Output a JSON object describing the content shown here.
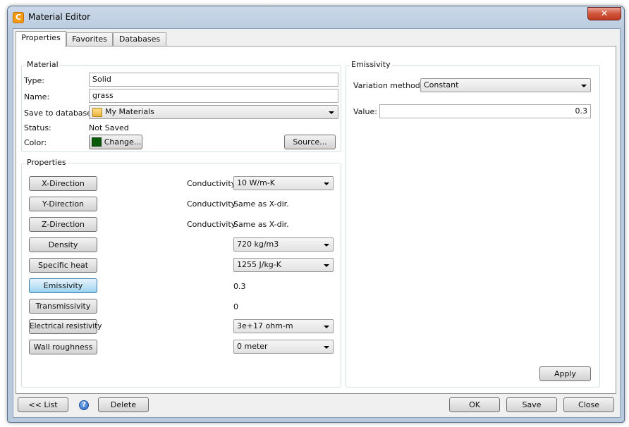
{
  "window": {
    "title": "Material Editor",
    "app_icon_letter": "C",
    "close_glyph": "✕"
  },
  "tabs": [
    {
      "label": "Properties",
      "active": true
    },
    {
      "label": "Favorites",
      "active": false
    },
    {
      "label": "Databases",
      "active": false
    }
  ],
  "material": {
    "group_label": "Material",
    "type_label": "Type:",
    "type_value": "Solid",
    "name_label": "Name:",
    "name_value": "grass",
    "save_to_db_label": "Save to database:",
    "save_to_db_value": "My Materials",
    "status_label": "Status:",
    "status_value": "Not Saved",
    "color_label": "Color:",
    "color_value": "#0a5a0a",
    "change_button": "Change...",
    "source_button": "Source..."
  },
  "properties": {
    "group_label": "Properties",
    "rows": [
      {
        "button": "X-Direction",
        "prefix": "Conductivity",
        "value": "10 W/m-K",
        "kind": "combo"
      },
      {
        "button": "Y-Direction",
        "prefix": "Conductivity",
        "value": "Same as X-dir.",
        "kind": "text"
      },
      {
        "button": "Z-Direction",
        "prefix": "Conductivity",
        "value": "Same as X-dir.",
        "kind": "text"
      },
      {
        "button": "Density",
        "prefix": "",
        "value": "720 kg/m3",
        "kind": "combo"
      },
      {
        "button": "Specific heat",
        "prefix": "",
        "value": "1255 J/kg-K",
        "kind": "combo"
      },
      {
        "button": "Emissivity",
        "prefix": "",
        "value": "0.3",
        "kind": "text",
        "active": true
      },
      {
        "button": "Transmissivity",
        "prefix": "",
        "value": "0",
        "kind": "text"
      },
      {
        "button": "Electrical resistivity",
        "prefix": "",
        "value": "3e+17 ohm-m",
        "kind": "combo"
      },
      {
        "button": "Wall roughness",
        "prefix": "",
        "value": "0 meter",
        "kind": "combo"
      }
    ]
  },
  "emissivity": {
    "group_label": "Emissivity",
    "variation_label": "Variation method:",
    "variation_value": "Constant",
    "value_label": "Value:",
    "value": "0.3",
    "apply_button": "Apply"
  },
  "footer": {
    "list_button": "<< List",
    "help_glyph": "?",
    "delete_button": "Delete",
    "ok_button": "OK",
    "save_button": "Save",
    "close_button": "Close"
  },
  "colors": {
    "accent_active": "#98d1ef",
    "swatch": "#0a5a0a",
    "close": "#c0391f"
  },
  "icons": [
    "app-logo-icon",
    "close-icon",
    "database-icon",
    "color-swatch-icon",
    "help-icon",
    "dropdown-arrow-icon"
  ]
}
